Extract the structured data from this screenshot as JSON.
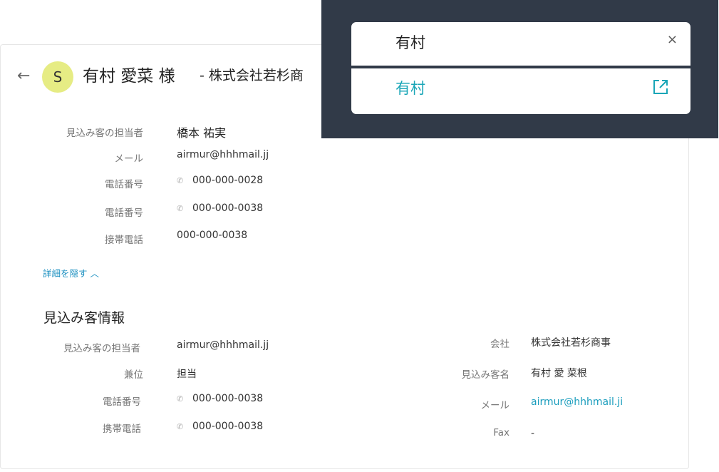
{
  "header": {
    "back_icon": "←",
    "avatar_letter": "S",
    "name": "有村 愛菜 様",
    "company": "- 株式会社若杉商"
  },
  "details": [
    {
      "label": "見込み客の担当者",
      "value": "橋本 祐実",
      "phone": false
    },
    {
      "label": "メール",
      "value": "airmur@hhhmail.jj",
      "phone": false
    },
    {
      "label": "電話番号",
      "value": "000-000-0028",
      "phone": true
    },
    {
      "label": "電話番号",
      "value": "000-000-0038",
      "phone": true
    },
    {
      "label": "接帯電話",
      "value": "000-000-0038",
      "phone": false
    }
  ],
  "toggle_label": "詳細を隠す",
  "toggle_icon": "^",
  "section_title": "見込み客情報",
  "lead_left": [
    {
      "label": "見込み客の担当者",
      "value": "airmur@hhhmail.jj",
      "phone": false
    },
    {
      "label": "兼位",
      "value": "担当",
      "phone": false
    },
    {
      "label": "電話番号",
      "value": "000-000-0038",
      "phone": true
    },
    {
      "label": "携帯電話",
      "value": "000-000-0038",
      "phone": true
    }
  ],
  "lead_right": [
    {
      "label": "会社",
      "value": "株式会社若杉商事"
    },
    {
      "label": "見込み客名",
      "value": "有村 愛 菜根"
    },
    {
      "label": "メール",
      "value": "airmur@hhhmail.ji"
    },
    {
      "label": "Fax",
      "value": "-"
    }
  ],
  "search": {
    "query": "有村",
    "close_icon": "×",
    "result": "有村",
    "result_icon": "external-link-icon"
  },
  "colors": {
    "overlay": "#313a48",
    "avatar": "#e6ec84",
    "link": "#1a9dbd",
    "result": "#1aa6b7"
  }
}
